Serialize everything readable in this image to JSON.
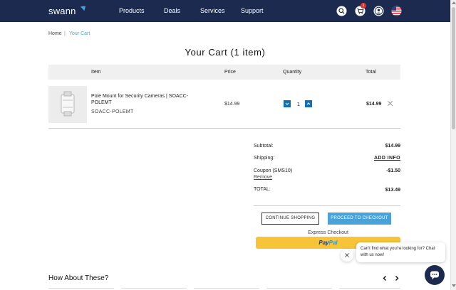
{
  "header": {
    "logo_text": "swann",
    "nav": [
      "Products",
      "Deals",
      "Services",
      "Support"
    ],
    "cart_count": "1",
    "colors": {
      "bar": "#1b2a4e",
      "accent": "#4aa3d8",
      "badge": "#e0322a"
    }
  },
  "breadcrumb": {
    "home": "Home",
    "separator": "|",
    "current": "Your Cart"
  },
  "page_title": "Your Cart (1 item)",
  "table": {
    "headers": {
      "item": "Item",
      "price": "Price",
      "quantity": "Quantity",
      "total": "Total"
    },
    "rows": [
      {
        "name": "Pole Mount for Security Cameras | SOACC-POLEMT",
        "sku": "SOACC-POLEMT",
        "price": "$14.99",
        "qty": "1",
        "total": "$14.99"
      }
    ]
  },
  "summary": {
    "subtotal_label": "Subtotal:",
    "subtotal": "$14.99",
    "shipping_label": "Shipping:",
    "shipping": "ADD INFO",
    "coupon_label": "Coupon (SMS10)",
    "coupon": "-$1.50",
    "remove_label": "Remove",
    "total_label": "TOTAL:",
    "total": "$13.49"
  },
  "actions": {
    "continue": "CONTINUE SHOPPING",
    "checkout": "PROCEED TO CHECKOUT",
    "express": "Express Checkout",
    "paypal_a": "Pay",
    "paypal_b": "Pal"
  },
  "chat": {
    "message": "Can't find what you're looking for? Chat with us now!"
  },
  "recommendations": {
    "title": "How About These?"
  }
}
